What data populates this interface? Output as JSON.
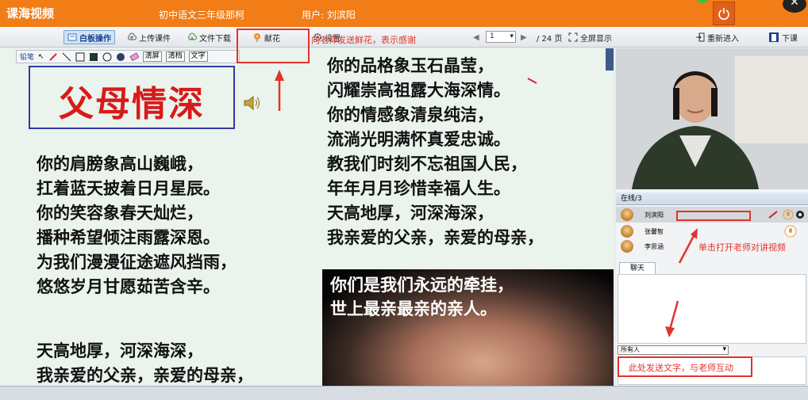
{
  "header": {
    "app_title": "课海视频",
    "course": "初中语文三年级那柯",
    "user": "用户: 刘滨阳"
  },
  "toolbar": {
    "whiteboard": "白板操作",
    "upload": "上传课件",
    "download": "文件下载",
    "flower": "献花",
    "settings": "设置",
    "page_value": "1",
    "page_total": "/ 24 页",
    "fullscreen": "全屏显示",
    "reenter": "重新进入",
    "leave": "下课"
  },
  "drawbar": {
    "pen": "铅笔",
    "clear_screen": "清屏",
    "clear_doc": "清档",
    "text": "文字"
  },
  "slide": {
    "title": "父母情深",
    "left_lines": [
      "你的肩膀象高山巍峨，",
      "扛着蓝天披着日月星辰。",
      "你的笑容象春天灿烂，",
      "播种希望倾注雨露深恩。",
      "为我们漫漫征途遮风挡雨，",
      "悠悠岁月甘愿茹苦含辛。"
    ],
    "left_lines_2": [
      "天高地厚，河深海深，",
      "我亲爱的父亲，亲爱的母亲，"
    ],
    "right_lines": [
      "你的品格象玉石晶莹，",
      "闪耀崇高祖露大海深情。",
      "你的情感象清泉纯洁，",
      "流淌光明满怀真爱忠诚。",
      "教我们时刻不忘祖国人民，",
      "年年月月珍惜幸福人生。",
      "天高地厚，河深海深，",
      "我亲爱的父亲，亲爱的母亲，"
    ],
    "photo_lines": [
      "你们是我们永远的牵挂，",
      "世上最亲最亲的亲人。"
    ]
  },
  "panel": {
    "online": "在线/3",
    "users": [
      "刘滨阳",
      "张馨智",
      "李思涵"
    ],
    "chat_tab": "聊天",
    "recipient": "所有人"
  },
  "annotations": {
    "flower_note": "向老师发送鲜花，表示感谢",
    "video_note": "单击打开老师对讲视频",
    "chat_note": "此处发送文字，与老师互动"
  },
  "colors": {
    "titlebar": "#f27d16",
    "annotation": "#e0342c",
    "slide_title": "#d81a1a"
  }
}
